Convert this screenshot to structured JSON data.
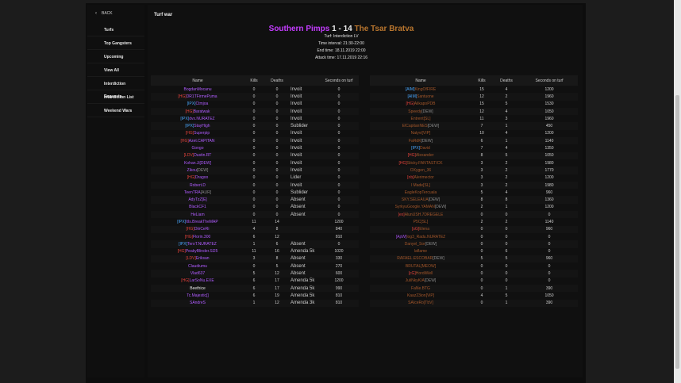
{
  "sidebar": {
    "back_label": "BACK",
    "items": [
      {
        "label": "Turfs"
      },
      {
        "label": "Top Gangsters"
      },
      {
        "label": "Upcoming"
      },
      {
        "label": "View All"
      },
      {
        "label": "Interdiction Requests"
      },
      {
        "label": "Interdiction List"
      },
      {
        "label": "Weekend Wars"
      }
    ]
  },
  "page": {
    "title": "Turf war"
  },
  "war": {
    "attacker": "Southern Pimps",
    "score": "1 - 14",
    "defender": "The Tsar Bratva",
    "attacker_color": "#c43cff",
    "defender_color": "#b8752e",
    "turf": "Turf: Interdiction LV",
    "time_interval": "Time interval: 21:30-22:00",
    "end_time": "End time: 18.11.2019 22:00",
    "attack_time": "Attack time: 17.11.2019 22:16"
  },
  "left_table": {
    "headers": {
      "name": "Name",
      "kills": "Kills",
      "deaths": "Deaths",
      "rank": "",
      "seconds": "Seconds on turf"
    },
    "rows": [
      {
        "tag": "",
        "tag_class": "",
        "name": "BogdanMocanu",
        "name_class": "name-violet",
        "kills": "0",
        "deaths": "0",
        "rank": "Invoit",
        "rank_class": "rank-yellow",
        "seconds": "0"
      },
      {
        "tag": "[HG]",
        "tag_class": "tag-red",
        "name": "DR1TFirmePuma",
        "name_class": "name-violet",
        "kills": "0",
        "deaths": "0",
        "rank": "Invoit",
        "rank_class": "rank-yellow",
        "seconds": "0"
      },
      {
        "tag": "[IPX]",
        "tag_class": "tag-blue",
        "name": "Ctmjoa",
        "name_class": "name-violet",
        "kills": "0",
        "deaths": "0",
        "rank": "Invoit",
        "rank_class": "rank-yellow",
        "seconds": "0"
      },
      {
        "tag": "[HG]",
        "tag_class": "tag-red",
        "name": "Baratwak",
        "name_class": "name-violet",
        "kills": "0",
        "deaths": "0",
        "rank": "Invoit",
        "rank_class": "rank-yellow",
        "seconds": "0"
      },
      {
        "tag": "[IPX]",
        "tag_class": "tag-blue",
        "name": "dvx.NURATEZ",
        "name_class": "name-violet",
        "kills": "0",
        "deaths": "0",
        "rank": "Invoit",
        "rank_class": "rank-yellow",
        "seconds": "0"
      },
      {
        "tag": "[IPX]",
        "tag_class": "tag-blue",
        "name": "StayHigh",
        "name_class": "name-violet",
        "kills": "0",
        "deaths": "0",
        "rank": "Sublider",
        "rank_class": "rank-yellow",
        "seconds": "0"
      },
      {
        "tag": "[HG]",
        "tag_class": "tag-red",
        "name": "Superpip",
        "name_class": "name-violet",
        "kills": "0",
        "deaths": "0",
        "rank": "Invoit",
        "rank_class": "rank-yellow",
        "seconds": "0"
      },
      {
        "tag": "[HG]",
        "tag_class": "tag-red",
        "name": "Azet.CAPITAN",
        "name_class": "name-violet",
        "kills": "0",
        "deaths": "0",
        "rank": "Invoit",
        "rank_class": "rank-yellow",
        "seconds": "0"
      },
      {
        "tag": "",
        "tag_class": "",
        "name": "Gongo",
        "name_class": "name-violet",
        "kills": "0",
        "deaths": "0",
        "rank": "Invoit",
        "rank_class": "rank-yellow",
        "seconds": "0"
      },
      {
        "tag": "[LDV]",
        "tag_class": "tag-red",
        "name": "Dustin.RT",
        "name_class": "name-violet",
        "kills": "0",
        "deaths": "0",
        "rank": "Invoit",
        "rank_class": "rank-yellow",
        "seconds": "0"
      },
      {
        "tag": "",
        "tag_class": "",
        "name": "Kohan.Ji[DEW]",
        "name_class": "name-violet",
        "kills": "0",
        "deaths": "0",
        "rank": "Invoit",
        "rank_class": "rank-yellow",
        "seconds": "0"
      },
      {
        "tag": "",
        "tag_class": "",
        "name": "Zikou",
        "name_class": "name-violet",
        "kills": "0",
        "deaths": "0",
        "rank": "Invoit",
        "rank_class": "rank-yellow",
        "seconds": "0",
        "suffix": "[DEW]",
        "suffix_class": "tag-gray"
      },
      {
        "tag": "[HG]",
        "tag_class": "tag-red",
        "name": "Dragoo",
        "name_class": "name-violet",
        "kills": "0",
        "deaths": "0",
        "rank": "Lider",
        "rank_class": "rank-yellow",
        "seconds": "0"
      },
      {
        "tag": "",
        "tag_class": "",
        "name": "Robert.D",
        "name_class": "name-violet",
        "kills": "0",
        "deaths": "0",
        "rank": "Invoit",
        "rank_class": "rank-yellow",
        "seconds": "0"
      },
      {
        "tag": "",
        "tag_class": "",
        "name": "TeenTRA",
        "name_class": "name-violet",
        "kills": "0",
        "deaths": "0",
        "rank": "Sublider",
        "rank_class": "rank-yellow",
        "seconds": "0",
        "suffix": "[AUR]",
        "suffix_class": "tag-gray"
      },
      {
        "tag": "",
        "tag_class": "",
        "name": "AdyTzZ[E]",
        "name_class": "name-violet",
        "kills": "0",
        "deaths": "0",
        "rank": "Absent",
        "rank_class": "rank-red",
        "seconds": "0"
      },
      {
        "tag": "",
        "tag_class": "",
        "name": "BlackCF1",
        "name_class": "name-violet",
        "kills": "0",
        "deaths": "0",
        "rank": "Absent",
        "rank_class": "rank-red",
        "seconds": "0"
      },
      {
        "tag": "",
        "tag_class": "",
        "name": "HeLiam",
        "name_class": "name-violet",
        "kills": "0",
        "deaths": "0",
        "rank": "Absent",
        "rank_class": "rank-red",
        "seconds": "0"
      },
      {
        "tag": "[IPX]",
        "tag_class": "tag-blue",
        "name": "ItIs.BreakTheMAP",
        "name_class": "name-violet",
        "kills": "11",
        "deaths": "14",
        "rank": "",
        "rank_class": "",
        "seconds": "1200"
      },
      {
        "tag": "[HG]",
        "tag_class": "tag-red",
        "name": "DiirCeRi",
        "name_class": "name-violet",
        "kills": "4",
        "deaths": "8",
        "rank": "",
        "rank_class": "",
        "seconds": "840"
      },
      {
        "tag": "[HG]",
        "tag_class": "tag-red",
        "name": "Florin.300",
        "name_class": "name-violet",
        "kills": "6",
        "deaths": "12",
        "rank": "",
        "rank_class": "",
        "seconds": "810"
      },
      {
        "tag": "[IPX]",
        "tag_class": "tag-blue",
        "name": "TeroT.NURATEZ",
        "name_class": "name-violet",
        "kills": "1",
        "deaths": "6",
        "rank": "Absent",
        "rank_class": "rank-red",
        "seconds": "0"
      },
      {
        "tag": "[HG]",
        "tag_class": "tag-red",
        "name": "PeakyBlinder.Sl25",
        "name_class": "name-violet",
        "kills": "11",
        "deaths": "16",
        "rank": "Amenda 5k",
        "rank_class": "rank-blue",
        "seconds": "1020"
      },
      {
        "tag": "[LDV]",
        "tag_class": "tag-red",
        "name": "Eriksan",
        "name_class": "name-violet",
        "kills": "3",
        "deaths": "8",
        "rank": "Absent",
        "rank_class": "rank-red",
        "seconds": "330"
      },
      {
        "tag": "",
        "tag_class": "",
        "name": "Claudiumu",
        "name_class": "name-violet",
        "kills": "0",
        "deaths": "5",
        "rank": "Absent",
        "rank_class": "rank-red",
        "seconds": "270"
      },
      {
        "tag": "",
        "tag_class": "",
        "name": "Vlad637",
        "name_class": "name-violet",
        "kills": "5",
        "deaths": "12",
        "rank": "Absent",
        "rank_class": "rank-red",
        "seconds": "600"
      },
      {
        "tag": "[HG]",
        "tag_class": "tag-red",
        "name": "LarSoNu.EXE",
        "name_class": "name-violet",
        "kills": "6",
        "deaths": "17",
        "rank": "Amenda 5k",
        "rank_class": "rank-blue",
        "seconds": "1200"
      },
      {
        "tag": "",
        "tag_class": "",
        "name": "Beethice",
        "name_class": "name-white",
        "kills": "6",
        "deaths": "17",
        "rank": "Amenda 5k",
        "rank_class": "rank-blue",
        "seconds": "990"
      },
      {
        "tag": "",
        "tag_class": "",
        "name": "Tc.Majestic[]",
        "name_class": "name-violet",
        "kills": "6",
        "deaths": "19",
        "rank": "Amenda 5k",
        "rank_class": "rank-blue",
        "seconds": "810"
      },
      {
        "tag": "",
        "tag_class": "",
        "name": "SAndreS",
        "name_class": "name-violet",
        "kills": "1",
        "deaths": "12",
        "rank": "Amenda 3k",
        "rank_class": "rank-blue",
        "seconds": "810"
      }
    ]
  },
  "right_table": {
    "headers": {
      "name": "Name",
      "kills": "Kills",
      "deaths": "Deaths",
      "seconds": "Seconds on turf"
    },
    "rows": [
      {
        "tag": "[AIM]",
        "tag_class": "tag-blue",
        "name": "KingOfFIRE",
        "kills": "15",
        "deaths": "4",
        "seconds": "1200"
      },
      {
        "tag": "[AIM]",
        "tag_class": "tag-blue",
        "name": "Santuone",
        "kills": "12",
        "deaths": "2",
        "seconds": "1960"
      },
      {
        "tag": "[HG]",
        "tag_class": "tag-red",
        "name": "AlikapoPDB",
        "kills": "15",
        "deaths": "5",
        "seconds": "1530"
      },
      {
        "tag": "",
        "tag_class": "",
        "name": "Speedy",
        "kills": "12",
        "deaths": "4",
        "seconds": "1050",
        "suffix": "[DEW]",
        "suffix_class": "tag-gray"
      },
      {
        "tag": "",
        "tag_class": "",
        "name": "Entrent[SL]",
        "kills": "11",
        "deaths": "3",
        "seconds": "1960"
      },
      {
        "tag": "",
        "tag_class": "",
        "name": "ElCapitanNES",
        "kills": "7",
        "deaths": "1",
        "seconds": "450",
        "suffix": "[DEW]",
        "suffix_class": "tag-gray"
      },
      {
        "tag": "",
        "tag_class": "",
        "name": "Natyvi[VIP]",
        "kills": "10",
        "deaths": "4",
        "seconds": "1200"
      },
      {
        "tag": "",
        "tag_class": "",
        "name": "FaRdK",
        "kills": "6",
        "deaths": "1",
        "seconds": "1140",
        "suffix": "[DEW]",
        "suffix_class": "tag-gray"
      },
      {
        "tag": "[IPX]",
        "tag_class": "tag-blue",
        "name": "David",
        "kills": "7",
        "deaths": "4",
        "seconds": "1350"
      },
      {
        "tag": "[HG]",
        "tag_class": "tag-red",
        "name": "Alexander",
        "kills": "8",
        "deaths": "5",
        "seconds": "1050"
      },
      {
        "tag": "[HG]",
        "tag_class": "tag-red",
        "name": "Sticky.FANTASTICK",
        "kills": "3",
        "deaths": "2",
        "seconds": "1980"
      },
      {
        "tag": "",
        "tag_class": "",
        "name": "OXygen_36",
        "kills": "3",
        "deaths": "2",
        "seconds": "1770"
      },
      {
        "tag": "[nb]",
        "tag_class": "tag-red",
        "name": "Alerimector",
        "kills": "3",
        "deaths": "2",
        "seconds": "1200"
      },
      {
        "tag": "",
        "tag_class": "",
        "name": "l Made[SL]",
        "kills": "3",
        "deaths": "2",
        "seconds": "1980"
      },
      {
        "tag": "",
        "tag_class": "",
        "name": "EagleKopTercuala",
        "kills": "5",
        "deaths": "4",
        "seconds": "960"
      },
      {
        "tag": "",
        "tag_class": "",
        "name": "SKY.SELEAUA",
        "kills": "8",
        "deaths": "8",
        "seconds": "1360",
        "suffix": "[DEW]",
        "suffix_class": "tag-gray"
      },
      {
        "tag": "",
        "tag_class": "",
        "name": "SyrkyuGoogle.YAMAN",
        "kills": "2",
        "deaths": "1",
        "seconds": "1200",
        "suffix": "[DEW]",
        "suffix_class": "tag-gray"
      },
      {
        "tag": "[ex]",
        "tag_class": "tag-red",
        "name": "AlunUSH.7DREGELE",
        "kills": "0",
        "deaths": "0",
        "seconds": "0"
      },
      {
        "tag": "",
        "tag_class": "",
        "name": "P5C[SL]",
        "kills": "2",
        "deaths": "2",
        "seconds": "1140"
      },
      {
        "tag": "[sG]",
        "tag_class": "tag-red",
        "name": "Elena",
        "kills": "0",
        "deaths": "0",
        "seconds": "960"
      },
      {
        "tag": "[ApW]",
        "tag_class": "tag-violet",
        "name": "log3_Radu.NURATEZ",
        "kills": "0",
        "deaths": "0",
        "seconds": "0"
      },
      {
        "tag": "",
        "tag_class": "",
        "name": "Danyel_Sor",
        "kills": "0",
        "deaths": "0",
        "seconds": "0",
        "suffix": "[DEW]",
        "suffix_class": "tag-gray"
      },
      {
        "tag": "",
        "tag_class": "",
        "name": "laflame",
        "kills": "0",
        "deaths": "6",
        "seconds": "0"
      },
      {
        "tag": "",
        "tag_class": "",
        "name": "RAFAEL.ESCOBAR",
        "kills": "5",
        "deaths": "5",
        "seconds": "960",
        "suffix": "[DEW]",
        "suffix_class": "tag-gray"
      },
      {
        "tag": "",
        "tag_class": "",
        "name": "BRUTAL[MEOW]",
        "kills": "0",
        "deaths": "0",
        "seconds": "0"
      },
      {
        "tag": "[cG]",
        "tag_class": "tag-red",
        "name": "HordiWell",
        "kills": "0",
        "deaths": "0",
        "seconds": "0"
      },
      {
        "tag": "",
        "tag_class": "",
        "name": "JuliNkyKIA",
        "kills": "0",
        "deaths": "0",
        "seconds": "0",
        "suffix": "[DEW]",
        "suffix_class": "tag-gray"
      },
      {
        "tag": "",
        "tag_class": "",
        "name": "FaNe.BTG",
        "kills": "0",
        "deaths": "1",
        "seconds": "390"
      },
      {
        "tag": "",
        "tag_class": "",
        "name": "Kaaz23ion[ViP]",
        "kills": "4",
        "deaths": "5",
        "seconds": "1050"
      },
      {
        "tag": "",
        "tag_class": "",
        "name": "SAIceRo[TbV]",
        "kills": "0",
        "deaths": "1",
        "seconds": "390"
      }
    ]
  }
}
